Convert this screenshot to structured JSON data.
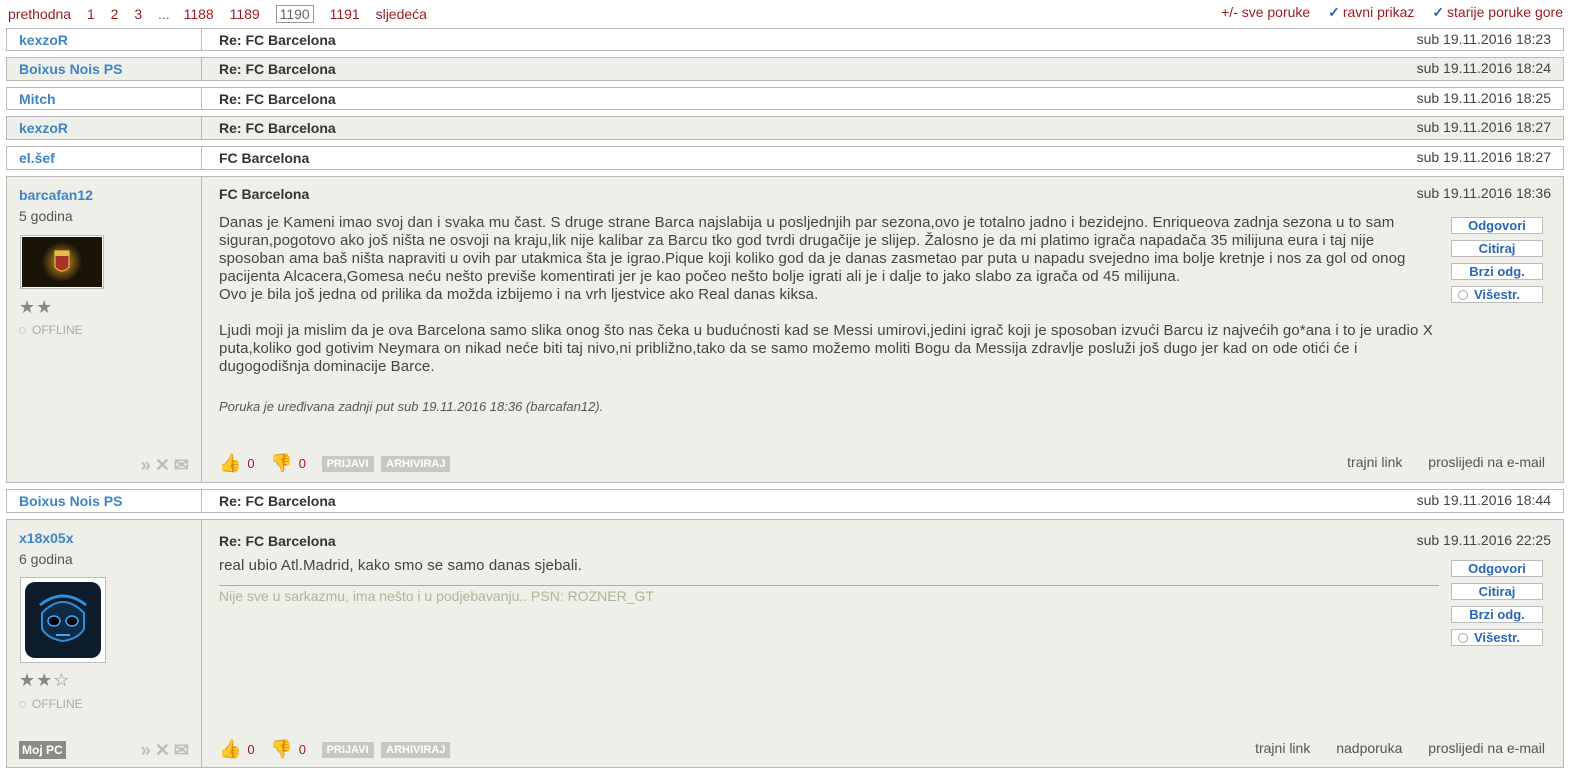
{
  "pagination": {
    "prev": "prethodna",
    "pages": [
      "1",
      "2",
      "3"
    ],
    "dots": "...",
    "pages2": [
      "1188",
      "1189"
    ],
    "current": "1190",
    "last": "1191",
    "next": "sljedeća"
  },
  "options": {
    "all": "+/- sve poruke",
    "flat": "ravni prikaz",
    "older": "starije poruke gore"
  },
  "rows": [
    {
      "user": "kexzoR",
      "subject": "Re: FC Barcelona",
      "date": "sub 19.11.2016 18:23"
    },
    {
      "user": "Boixus Nois PS",
      "subject": "Re: FC Barcelona",
      "date": "sub 19.11.2016 18:24"
    },
    {
      "user": "Mitch",
      "subject": "Re: FC Barcelona",
      "date": "sub 19.11.2016 18:25"
    },
    {
      "user": "kexzoR",
      "subject": "Re: FC Barcelona",
      "date": "sub 19.11.2016 18:27"
    },
    {
      "user": "el.šef",
      "subject": "FC Barcelona",
      "date": "sub 19.11.2016 18:27"
    },
    {
      "user": "Boixus Nois PS",
      "subject": "Re: FC Barcelona",
      "date": "sub 19.11.2016 18:44"
    }
  ],
  "post1": {
    "user": "barcafan12",
    "age": "5 godina",
    "stars": "★★",
    "status": "OFFLINE",
    "title": "FC Barcelona",
    "date": "sub 19.11.2016 18:36",
    "p1": "Danas je Kameni imao svoj dan i svaka mu čast. S druge strane Barca najslabija u posljednjih par sezona,ovo je totalno jadno i bezidejno. Enriqueova zadnja sezona u to sam siguran,pogotovo ako još ništa ne osvoji na kraju,lik nije kalibar za Barcu tko god tvrdi drugačije je slijep. Žalosno je da mi platimo igrača napadača 35 milijuna eura i taj nije sposoban ama baš ništa napraviti u ovih par utakmica šta je igrao.Pique koji koliko god da je danas zasmetao par puta u napadu svejedno ima bolje kretnje i nos za gol od onog pacijenta Alcacera,Gomesa neću nešto previše komentirati jer je kao počeo nešto bolje igrati ali je i dalje to jako slabo za igrača od 45 milijuna.",
    "p2": "Ovo je bila još jedna od prilika da možda izbijemo i na vrh ljestvice ako Real danas kiksa.",
    "p3": "Ljudi moji ja mislim da je ova Barcelona samo slika onog što nas čeka u budućnosti kad se Messi umirovi,jedini igrač koji je sposoban izvući Barcu iz najvećih go*ana i to je uradio X puta,koliko god gotivim Neymara on nikad neće biti taj nivo,ni približno,tako da se samo možemo moliti Bogu da Messija zdravlje posluži još dugo jer kad on ode otići će i dugogodišnja dominacije Barce.",
    "edited": "Poruka je uređivana zadnji put sub 19.11.2016 18:36 (barcafan12).",
    "likes": "0",
    "dislikes": "0",
    "links": [
      "trajni link",
      "proslijedi na e-mail"
    ]
  },
  "post2": {
    "user": "x18x05x",
    "age": "6 godina",
    "stars": "★★☆",
    "status": "OFFLINE",
    "badge": "Moj PC",
    "title": "Re: FC Barcelona",
    "date": "sub 19.11.2016 22:25",
    "body": "real ubio Atl.Madrid, kako smo se samo danas sjebali.",
    "signature": "Nije sve u sarkazmu, ima nešto i u podjebavanju.. PSN: ROZNER_GT",
    "likes": "0",
    "dislikes": "0",
    "links": [
      "trajni link",
      "nadporuka",
      "proslijedi na e-mail"
    ]
  },
  "buttons": {
    "reply": "Odgovori",
    "quote": "Citiraj",
    "quick": "Brzi odg.",
    "multi": "Višestr."
  },
  "tags": {
    "report": "PRIJAVI",
    "archive": "ARHIVIRAJ"
  },
  "colors": {
    "link": "#3f84c4",
    "accent": "#9b1b1b",
    "panel": "#efefe9"
  }
}
